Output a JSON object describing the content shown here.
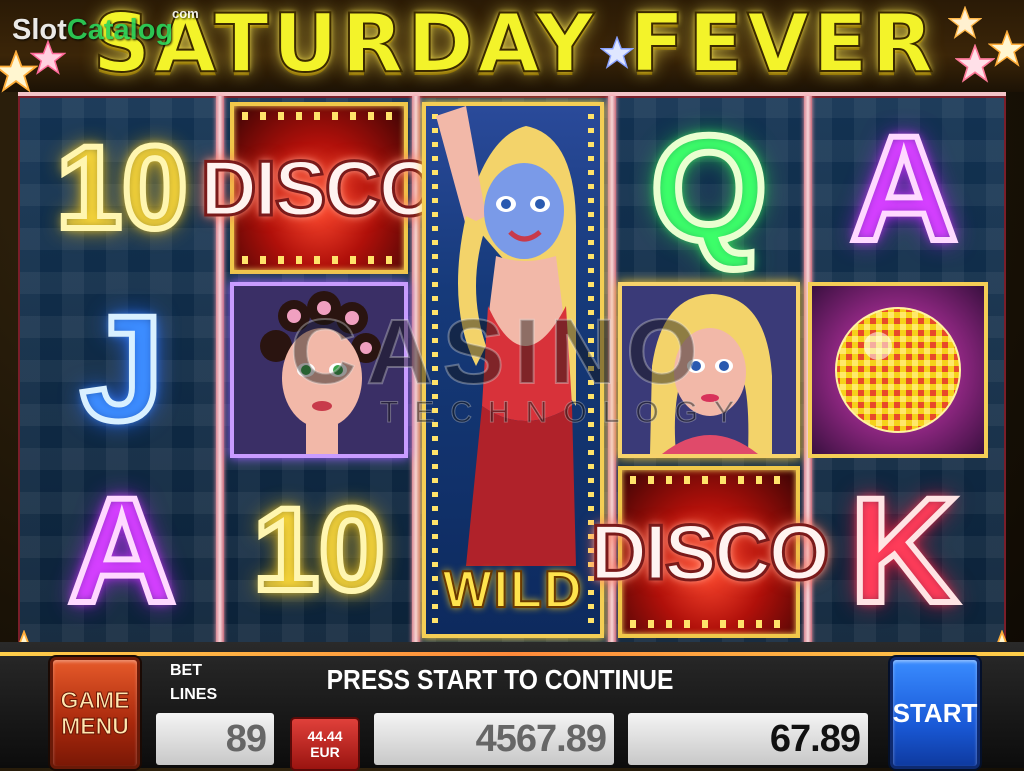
{
  "header": {
    "title": "SATURDAY FEVER",
    "watermark": {
      "part1": "Slot",
      "part2": "Catalog",
      "suffix": "com"
    }
  },
  "reels": [
    [
      "10",
      "J",
      "A"
    ],
    [
      "DISCO",
      "woman-curlers-portrait",
      "10"
    ],
    [
      "WILD"
    ],
    [
      "Q",
      "blonde-woman-portrait",
      "DISCO"
    ],
    [
      "A",
      "disco-ball",
      "K"
    ]
  ],
  "symbols": {
    "ten": "10",
    "jack": "J",
    "ace": "A",
    "queen": "Q",
    "king": "K",
    "disco": "DISCO",
    "wild": "WILD"
  },
  "overlay_logo": {
    "main": "CASINO",
    "sub": "TECHNOLOGY"
  },
  "panel": {
    "game_menu_line1": "GAME",
    "game_menu_line2": "MENU",
    "bet_label": "BET",
    "lines_label": "LINES",
    "message": "PRESS START TO CONTINUE",
    "lines_value": "89",
    "denomination_value": "44.44",
    "denomination_currency": "EUR",
    "credit_value": "4567.89",
    "win_value": "67.89",
    "start_label": "START"
  },
  "colors": {
    "title": "#f3f32a",
    "reel_bg": "#123252",
    "start_button": "#1a5ad8",
    "menu_button": "#a8280c"
  }
}
